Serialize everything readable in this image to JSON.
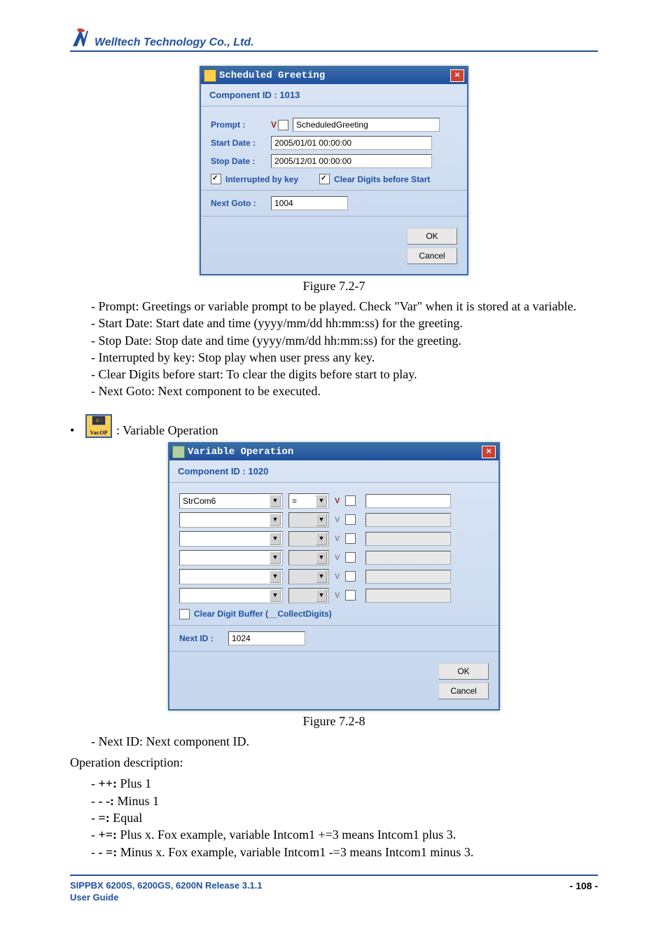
{
  "header": {
    "company": "Welltech Technology Co., Ltd."
  },
  "dlg1": {
    "title": "Scheduled Greeting",
    "comp": "Component ID : 1013",
    "prompt_label": "Prompt :",
    "prompt_v": "V",
    "prompt_val": "ScheduledGreeting",
    "start_label": "Start Date :",
    "start_val": "2005/01/01 00:00:00",
    "stop_label": "Stop Date :",
    "stop_val": "2005/12/01 00:00:00",
    "int_key": "Interrupted by key",
    "clear_dig": "Clear Digits before Start",
    "next_label": "Next Goto :",
    "next_val": "1004",
    "ok": "OK",
    "cancel": "Cancel"
  },
  "fig1": "Figure 7.2-7",
  "notes1": {
    "a": "Prompt: Greetings or variable prompt to be played. Check \"Var\" when it is stored at a variable.",
    "b": "Start Date: Start date and time (yyyy/mm/dd hh:mm:ss) for the greeting.",
    "c": "Stop Date: Stop date and time (yyyy/mm/dd hh:mm:ss) for the greeting.",
    "d": "Interrupted by key: Stop play when user press any key.",
    "e": "Clear Digits before start: To clear the digits before start to play.",
    "f": "Next Goto: Next component to be executed."
  },
  "varop_label": ": Variable Operation",
  "varop_icon_top": "±□",
  "varop_icon_bot": "Var.OP",
  "dlg2": {
    "title": "Variable Operation",
    "comp": "Component ID : 1020",
    "row1_var": "StrCom6",
    "row1_op": "=",
    "v": "V",
    "clearbuf": "Clear Digit Buffer (__CollectDigits)",
    "next_label": "Next ID :",
    "next_val": "1024",
    "ok": "OK",
    "cancel": "Cancel"
  },
  "fig2": "Figure 7.2-8",
  "notes2": {
    "a": "Next ID: Next component ID."
  },
  "opdesc_label": "Operation description:",
  "opdesc": {
    "a_b": "++:",
    "a_t": " Plus 1",
    "b_b": "- -:",
    "b_t": " Minus 1",
    "c_b": "=:",
    "c_t": " Equal",
    "d_b": "+=:",
    "d_t": " Plus x. Fox example, variable Intcom1 +=3 means Intcom1 plus 3.",
    "e_b": "- =:",
    "e_t": " Minus x. Fox example, variable Intcom1 -=3 means Intcom1 minus 3."
  },
  "footer": {
    "line1": "SIPPBX 6200S, 6200GS, 6200N Release 3.1.1",
    "line2": "User Guide",
    "page": "- 108 -"
  }
}
